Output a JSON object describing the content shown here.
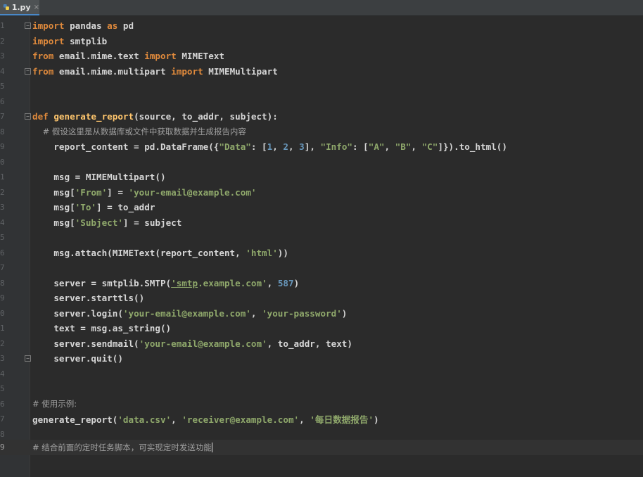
{
  "tab": {
    "label": "1.py",
    "close": "×"
  },
  "line_numbers": [
    "1",
    "2",
    "3",
    "4",
    "5",
    "6",
    "7",
    "8",
    "9",
    "0",
    "1",
    "2",
    "3",
    "4",
    "5",
    "6",
    "7",
    "8",
    "9",
    "0",
    "1",
    "2",
    "3",
    "4",
    "5",
    "6",
    "7",
    "8",
    "9"
  ],
  "code": {
    "l1": [
      "import",
      " pandas ",
      "as",
      " pd"
    ],
    "l2": [
      "import",
      " smtplib"
    ],
    "l3": [
      "from",
      " email.mime.text ",
      "import",
      " MIMEText"
    ],
    "l4": [
      "from",
      " email.mime.multipart ",
      "import",
      " MIMEMultipart"
    ],
    "l7": [
      "def",
      " ",
      "generate_report",
      "(source, to_addr, subject):"
    ],
    "l8": "    # 假设这里是从数据库或文件中获取数据并生成报告内容",
    "l9": [
      "    report_content = pd.DataFrame({",
      "\"Data\"",
      ": [",
      "1",
      ", ",
      "2",
      ", ",
      "3",
      "], ",
      "\"Info\"",
      ": [",
      "\"A\"",
      ", ",
      "\"B\"",
      ", ",
      "\"C\"",
      "]}).to_html()"
    ],
    "l11": "    msg = MIMEMultipart()",
    "l12": [
      "    msg[",
      "'From'",
      "] = ",
      "'your-email@example.com'"
    ],
    "l13": [
      "    msg[",
      "'To'",
      "] = to_addr"
    ],
    "l14": [
      "    msg[",
      "'Subject'",
      "] = subject"
    ],
    "l16": [
      "    msg.attach(MIMEText(report_content, ",
      "'html'",
      "))"
    ],
    "l18": [
      "    server = smtplib.SMTP(",
      "'smtp",
      ".example.com'",
      ", ",
      "587",
      ")"
    ],
    "l19": "    server.starttls()",
    "l20": [
      "    server.login(",
      "'your-email@example.com'",
      ", ",
      "'your-password'",
      ")"
    ],
    "l21": "    text = msg.as_string()",
    "l22": [
      "    server.sendmail(",
      "'your-email@example.com'",
      ", to_addr, text)"
    ],
    "l23": "    server.quit()",
    "l26": "# 使用示例:",
    "l27": [
      "generate_report(",
      "'data.csv'",
      ", ",
      "'receiver@example.com'",
      ", ",
      "'每日数据报告'",
      ")"
    ],
    "l29": "# 结合前面的定时任务脚本，可实现定时发送功能"
  },
  "colors": {
    "keyword": "#e08a3c",
    "function": "#ffc66d",
    "string": "#8fa86b",
    "number": "#6897bb",
    "comment": "#a0a0a0",
    "background": "#2b2b2b"
  }
}
